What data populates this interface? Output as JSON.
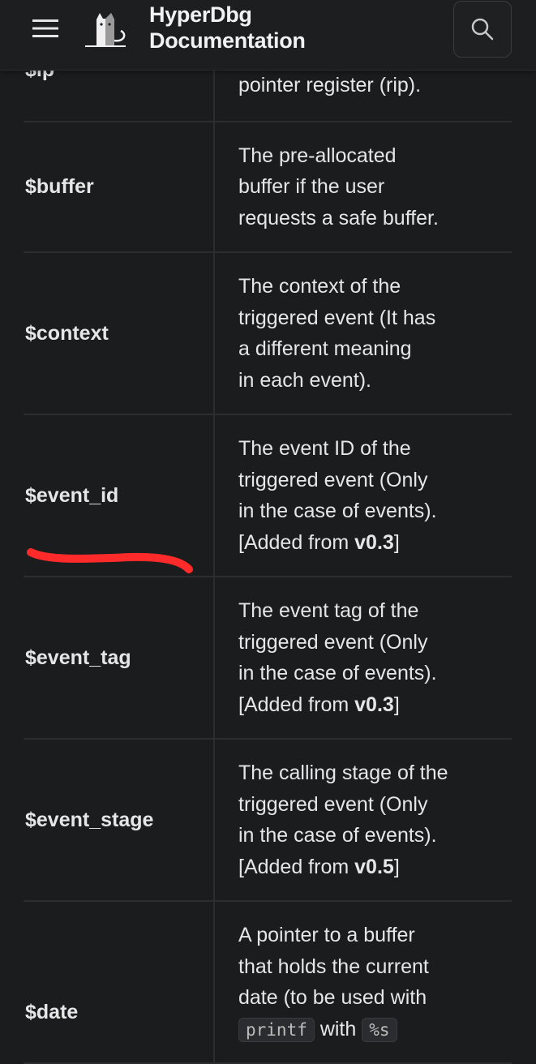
{
  "header": {
    "title_line1": "HyperDbg",
    "title_line2": "Documentation",
    "menu_icon": "hamburger-menu-icon",
    "logo_icon": "cat-logo-icon",
    "search_icon": "search-icon"
  },
  "table": {
    "rows": [
      {
        "name": "$ip",
        "desc_lines": [
          "pointer register (rip)."
        ]
      },
      {
        "name": "$buffer",
        "desc_lines": [
          "The pre-allocated",
          "buffer if the user",
          "requests a safe buffer."
        ]
      },
      {
        "name": "$context",
        "desc_lines": [
          "The context of the",
          "triggered event (It has",
          "a different meaning",
          "in each event)."
        ]
      },
      {
        "name": "$event_id",
        "desc_lines": [
          "The event ID of the",
          "triggered event (Only",
          "in the case of events)."
        ],
        "added_prefix": "[Added from ",
        "added_version": "v0.3",
        "added_suffix": "]"
      },
      {
        "name": "$event_tag",
        "desc_lines": [
          "The event tag of the",
          "triggered event (Only",
          "in the case of events)."
        ],
        "added_prefix": "[Added from ",
        "added_version": "v0.3",
        "added_suffix": "]"
      },
      {
        "name": "$event_stage",
        "desc_lines": [
          "The calling stage of the",
          "triggered event (Only",
          "in the case of events)."
        ],
        "added_prefix": "[Added from ",
        "added_version": "v0.5",
        "added_suffix": "]"
      },
      {
        "name": "$date",
        "desc_lines": [
          "A pointer to a buffer",
          "that holds the current",
          "date (to be used with"
        ],
        "code1": "printf",
        "between": "with",
        "code2": "%s"
      }
    ]
  },
  "annotation_color": "#ff2a2a",
  "colors": {
    "background": "#1b1c1d",
    "text": "#e6e6e6",
    "border": "#2c2d30"
  }
}
